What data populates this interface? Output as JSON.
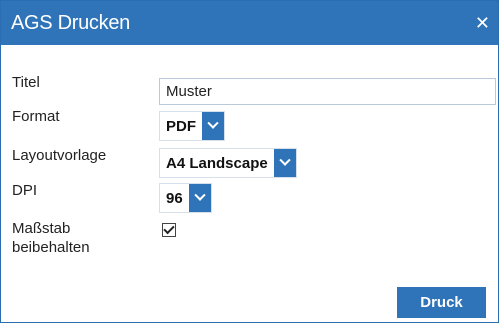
{
  "dialog": {
    "title": "AGS Drucken",
    "close_icon": "close-icon"
  },
  "form": {
    "titel_label": "Titel",
    "titel_value": "Muster",
    "format_label": "Format",
    "format_value": "PDF",
    "layout_label": "Layoutvorlage",
    "layout_value": "A4 Landscape",
    "dpi_label": "DPI",
    "dpi_value": "96",
    "scale_label_line1": "Maßstab",
    "scale_label_line2": "beibehalten",
    "scale_checked": true
  },
  "actions": {
    "print_label": "Druck"
  },
  "colors": {
    "accent": "#2f73b8",
    "background": "#ffffff"
  }
}
